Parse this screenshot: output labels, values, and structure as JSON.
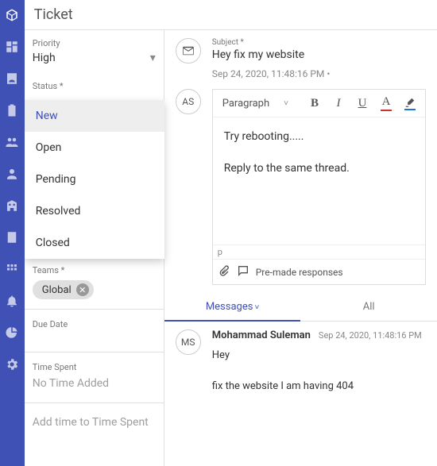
{
  "header": {
    "title": "Ticket"
  },
  "sidebar": {
    "priority_label": "Priority",
    "priority_value": "High",
    "status_label_partial": "Status *",
    "status_options": [
      "New",
      "Open",
      "Pending",
      "Resolved",
      "Closed"
    ],
    "status_selected": "New",
    "teams_label": "Teams *",
    "team_chip": "Global",
    "due_date_label": "Due Date",
    "time_spent_label": "Time Spent",
    "time_spent_value": "No Time Added",
    "add_time_placeholder": "Add time to Time Spent"
  },
  "message": {
    "subject_label": "Subject *",
    "subject_value": "Hey fix my website",
    "timestamp": "Sep 24, 2020, 11:48:16 PM  •"
  },
  "editor": {
    "para_label": "Paragraph",
    "body_line1": "Try rebooting.....",
    "body_line2": "Reply to the same thread.",
    "path": "p",
    "premade_label": "Pre-made responses"
  },
  "tabs": {
    "messages": "Messages",
    "all": "All"
  },
  "thread": {
    "initials": "MS",
    "author": "Mohammad Suleman",
    "time": "Sep 24, 2020, 11:48:16 PM",
    "line1": "Hey",
    "line2": "fix the website I am having 404"
  },
  "reply_initials": "AS"
}
